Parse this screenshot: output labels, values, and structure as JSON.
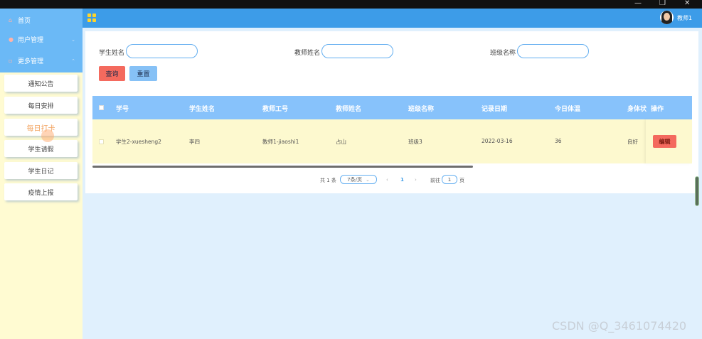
{
  "window": {
    "minimize": "—",
    "restore": "❐",
    "close": "✕"
  },
  "sidebar": {
    "home": "首页",
    "groups": [
      "用户管理",
      "更多管理"
    ],
    "items": [
      "通知公告",
      "每日安排",
      "每日打卡",
      "学生请假",
      "学生日记",
      "疫情上报"
    ],
    "active_index": 2
  },
  "header": {
    "user": "教师1"
  },
  "search": {
    "student_name_label": "学生姓名",
    "teacher_name_label": "教师姓名",
    "class_name_label": "班级名称",
    "search_button": "查询",
    "reset_button": "重置"
  },
  "table": {
    "columns": [
      "学号",
      "学生姓名",
      "教师工号",
      "教师姓名",
      "班级名称",
      "记录日期",
      "今日体温",
      "身体状",
      "操作"
    ],
    "rows": [
      {
        "student_id": "学生2-xuesheng2",
        "student_name": "李四",
        "teacher_id": "教师1-jiaoshi1",
        "teacher_name": "占山",
        "class_name": "班级3",
        "date": "2022-03-16",
        "temperature": "36",
        "health": "良好",
        "edit": "编辑"
      }
    ]
  },
  "pagination": {
    "total": "共 1 条",
    "page_size": "7条/页",
    "current": "1",
    "goto_label": "前往",
    "goto_value": "1",
    "page_unit": "页"
  },
  "watermark": "CSDN @Q_3461074420"
}
